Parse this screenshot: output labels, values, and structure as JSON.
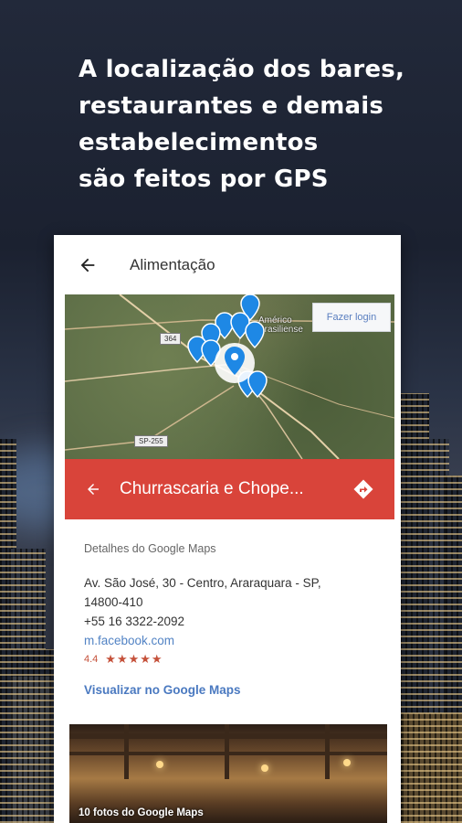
{
  "headline": {
    "line1": "A localização dos bares,",
    "line2": "restaurantes e demais",
    "line3": "estabelecimentos",
    "line4": "são feitos por GPS"
  },
  "appbar": {
    "title": "Alimentação",
    "back_icon": "arrow-left-icon"
  },
  "map": {
    "login_button": "Fazer login",
    "road_tags": [
      "364",
      "SP-255"
    ],
    "town_label_line1": "Américo",
    "town_label_line2": "Brasiliense",
    "marker_icon": "map-pin-icon",
    "pin_color": "#1e88e5"
  },
  "place": {
    "name": "Churrascaria e Chope...",
    "bar_color": "#d9443a",
    "back_icon": "arrow-left-icon",
    "directions_icon": "directions-icon"
  },
  "details": {
    "section_label": "Detalhes do Google Maps",
    "address_line1": "Av. São José, 30 - Centro, Araraquara - SP,",
    "address_line2": "14800-410",
    "phone": "+55 16 3322-2092",
    "website": "m.facebook.com",
    "rating": "4.4",
    "stars": "★★★★★",
    "view_link": "Visualizar no Google Maps"
  },
  "photo": {
    "caption": "10 fotos do Google Maps"
  }
}
